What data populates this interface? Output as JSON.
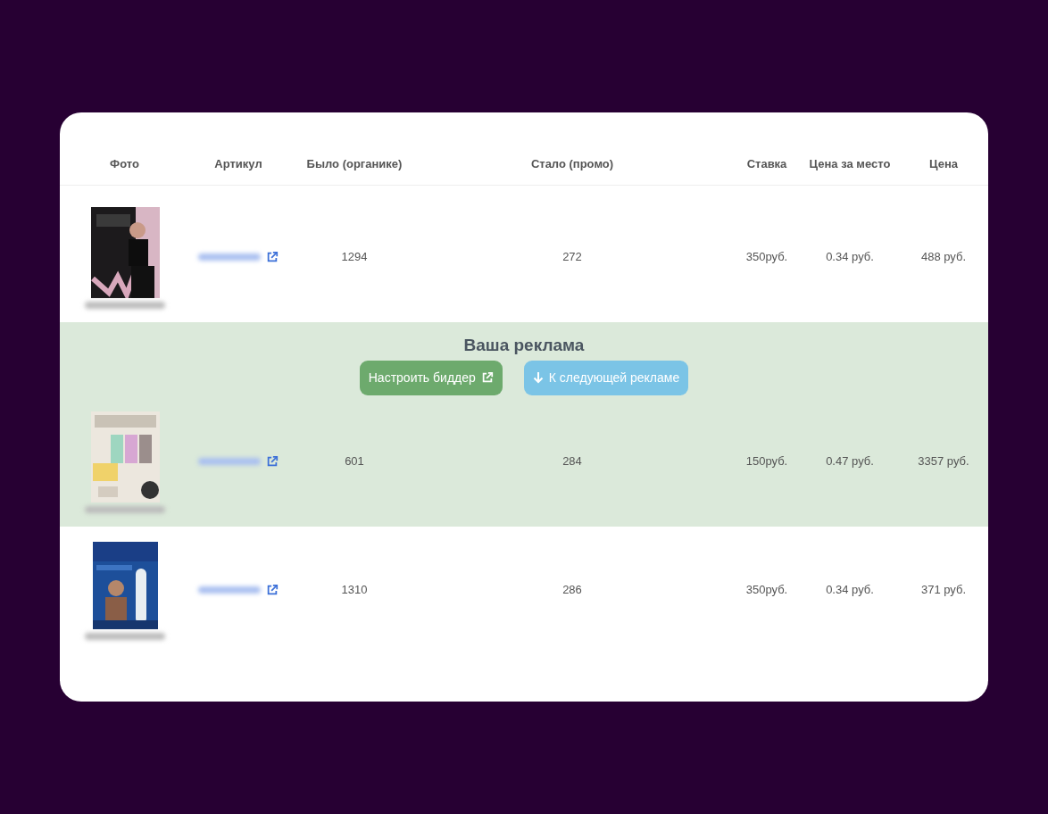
{
  "table": {
    "columns": [
      "Фото",
      "Артикул",
      "Было (органике)",
      "Стало (промо)",
      "Ставка",
      "Цена за место",
      "Цена"
    ],
    "rows": [
      {
        "highlighted": false,
        "was": "1294",
        "now": "272",
        "bid": "350руб.",
        "price_per_place": "0.34 руб.",
        "price": "488 руб."
      },
      {
        "highlighted": true,
        "was": "601",
        "now": "284",
        "bid": "150руб.",
        "price_per_place": "0.47 руб.",
        "price": "3357 руб."
      },
      {
        "highlighted": false,
        "was": "1310",
        "now": "286",
        "bid": "350руб.",
        "price_per_place": "0.34 руб.",
        "price": "371 руб."
      }
    ]
  },
  "ad_banner": {
    "title": "Ваша реклама",
    "buttons": [
      {
        "label": "Настроить биддер",
        "kind": "bidder"
      },
      {
        "label": "К следующей рекламе",
        "kind": "next"
      }
    ]
  }
}
